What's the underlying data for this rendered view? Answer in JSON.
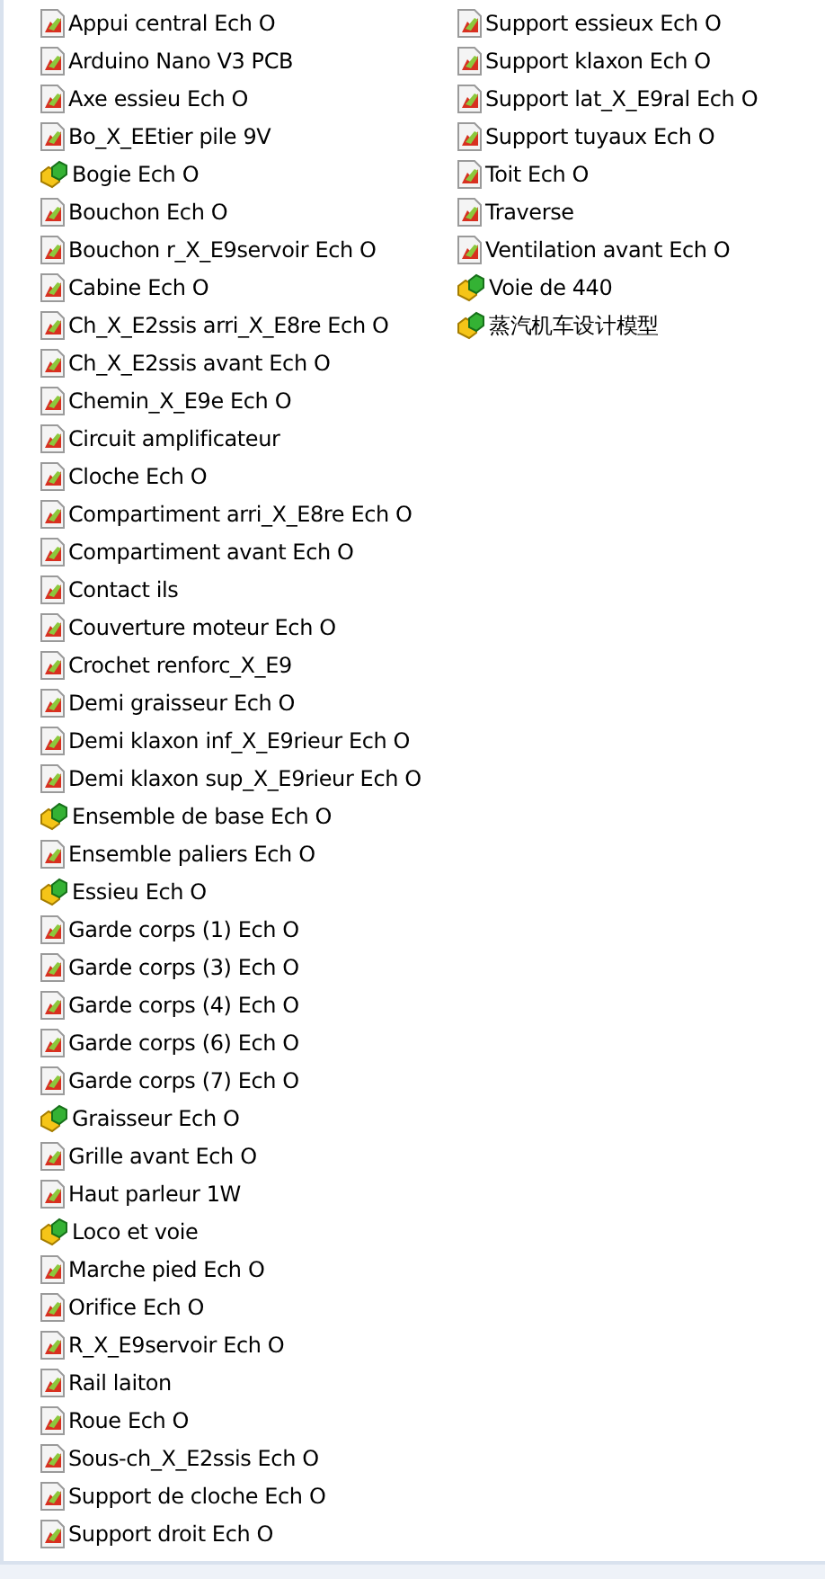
{
  "files": [
    {
      "name": "Appui central Ech O",
      "kind": "part"
    },
    {
      "name": "Arduino Nano V3 PCB",
      "kind": "part"
    },
    {
      "name": "Axe essieu Ech O",
      "kind": "part"
    },
    {
      "name": "Bo_X_EEtier pile 9V",
      "kind": "part"
    },
    {
      "name": "Bogie Ech O",
      "kind": "assembly"
    },
    {
      "name": "Bouchon Ech O",
      "kind": "part"
    },
    {
      "name": "Bouchon r_X_E9servoir Ech O",
      "kind": "part"
    },
    {
      "name": "Cabine Ech O",
      "kind": "part"
    },
    {
      "name": "Ch_X_E2ssis arri_X_E8re Ech O",
      "kind": "part"
    },
    {
      "name": "Ch_X_E2ssis avant Ech O",
      "kind": "part"
    },
    {
      "name": "Chemin_X_E9e Ech O",
      "kind": "part"
    },
    {
      "name": "Circuit amplificateur",
      "kind": "part"
    },
    {
      "name": "Cloche Ech O",
      "kind": "part"
    },
    {
      "name": "Compartiment arri_X_E8re Ech O",
      "kind": "part"
    },
    {
      "name": "Compartiment avant Ech O",
      "kind": "part"
    },
    {
      "name": "Contact ils",
      "kind": "part"
    },
    {
      "name": "Couverture moteur Ech O",
      "kind": "part"
    },
    {
      "name": "Crochet renforc_X_E9",
      "kind": "part"
    },
    {
      "name": "Demi graisseur Ech O",
      "kind": "part"
    },
    {
      "name": "Demi klaxon inf_X_E9rieur Ech O",
      "kind": "part"
    },
    {
      "name": "Demi klaxon sup_X_E9rieur Ech O",
      "kind": "part"
    },
    {
      "name": "Ensemble de base Ech O",
      "kind": "assembly"
    },
    {
      "name": "Ensemble paliers Ech O",
      "kind": "part"
    },
    {
      "name": "Essieu Ech O",
      "kind": "assembly"
    },
    {
      "name": "Garde corps (1) Ech O",
      "kind": "part"
    },
    {
      "name": "Garde corps (3) Ech O",
      "kind": "part"
    },
    {
      "name": "Garde corps (4) Ech O",
      "kind": "part"
    },
    {
      "name": "Garde corps (6) Ech O",
      "kind": "part"
    },
    {
      "name": "Garde corps (7) Ech O",
      "kind": "part"
    },
    {
      "name": "Graisseur Ech O",
      "kind": "assembly"
    },
    {
      "name": "Grille avant Ech O",
      "kind": "part"
    },
    {
      "name": "Haut parleur 1W",
      "kind": "part"
    },
    {
      "name": "Loco et voie",
      "kind": "assembly"
    },
    {
      "name": "Marche pied Ech O",
      "kind": "part"
    },
    {
      "name": "Orifice Ech O",
      "kind": "part"
    },
    {
      "name": "R_X_E9servoir Ech O",
      "kind": "part"
    },
    {
      "name": "Rail laiton",
      "kind": "part"
    },
    {
      "name": "Roue Ech O",
      "kind": "part"
    },
    {
      "name": "Sous-ch_X_E2ssis Ech O",
      "kind": "part"
    },
    {
      "name": "Support de cloche Ech O",
      "kind": "part"
    },
    {
      "name": "Support droit Ech O",
      "kind": "part"
    },
    {
      "name": "Support essieux Ech O",
      "kind": "part"
    },
    {
      "name": "Support klaxon Ech O",
      "kind": "part"
    },
    {
      "name": "Support lat_X_E9ral Ech O",
      "kind": "part"
    },
    {
      "name": "Support tuyaux Ech O",
      "kind": "part"
    },
    {
      "name": "Toit Ech O",
      "kind": "part"
    },
    {
      "name": "Traverse",
      "kind": "part"
    },
    {
      "name": "Ventilation avant Ech O",
      "kind": "part"
    },
    {
      "name": "Voie de 440",
      "kind": "assembly"
    },
    {
      "name": "蒸汽机车设计模型",
      "kind": "assembly"
    }
  ]
}
